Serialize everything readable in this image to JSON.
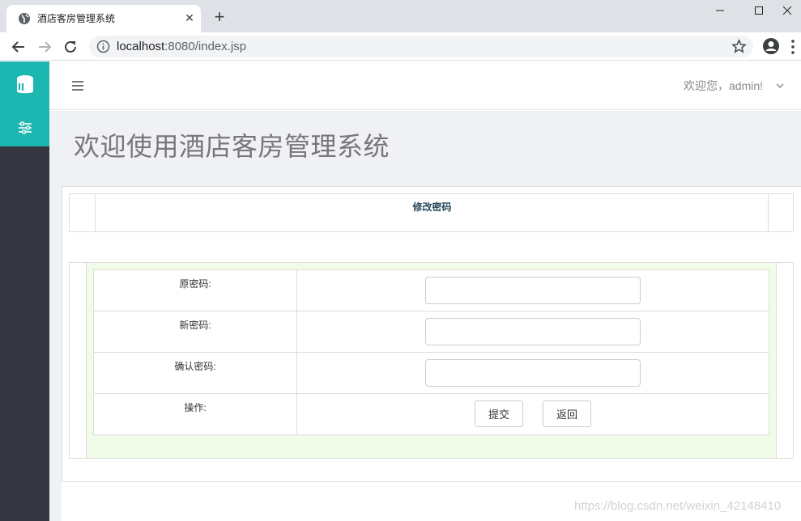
{
  "browser": {
    "tab_title": "酒店客房管理系统",
    "url_host": "localhost",
    "url_rest": ":8080/index.jsp"
  },
  "sidebar": {
    "accent_color": "#1bb7b0",
    "icons": [
      "database-icon",
      "sliders-icon"
    ]
  },
  "header": {
    "welcome": "欢迎您，admin!"
  },
  "page": {
    "title": "欢迎使用酒店客房管理系统"
  },
  "panel": {
    "heading": "修改密码"
  },
  "form": {
    "rows": [
      {
        "label": "原密码:",
        "value": ""
      },
      {
        "label": "新密码:",
        "value": ""
      },
      {
        "label": "确认密码:",
        "value": ""
      },
      {
        "label": "操作:"
      }
    ],
    "submit_label": "提交",
    "back_label": "返回"
  },
  "watermark": "https://blog.csdn.net/weixin_42148410"
}
